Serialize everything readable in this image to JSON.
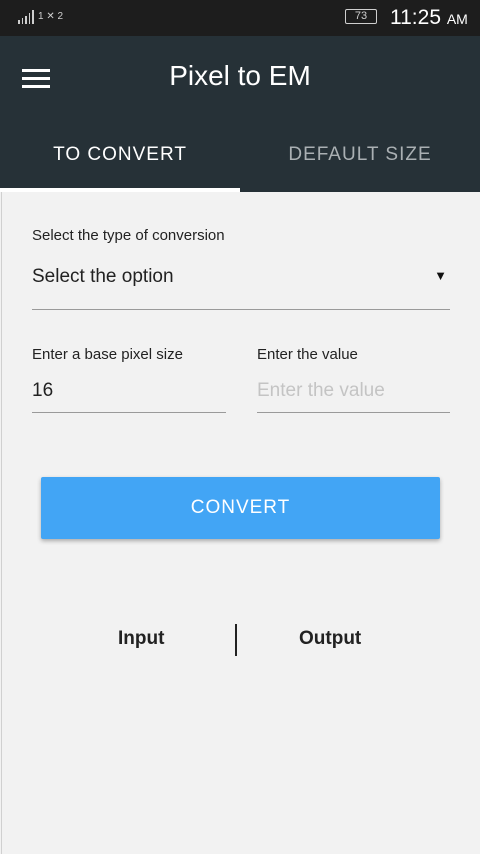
{
  "status_bar": {
    "sim_label": "1 ✕ 2",
    "battery": "73",
    "time": "11:25",
    "ampm": "AM"
  },
  "app_bar": {
    "title": "Pixel to EM",
    "menu_icon": "hamburger-menu-icon"
  },
  "tabs": [
    {
      "label": "TO CONVERT",
      "active": true
    },
    {
      "label": "DEFAULT SIZE",
      "active": false
    }
  ],
  "form": {
    "conversion_label": "Select the type of conversion",
    "conversion_value": "Select the option",
    "caret": "▼",
    "base_label": "Enter a base pixel size",
    "base_value": "16",
    "value_label": "Enter the value",
    "value_placeholder": "Enter the value",
    "value_value": ""
  },
  "convert_button": "CONVERT",
  "result": {
    "input_label": "Input",
    "output_label": "Output"
  },
  "colors": {
    "appbar": "#263137",
    "button": "#42a5f5",
    "background": "#f2f2f2"
  }
}
